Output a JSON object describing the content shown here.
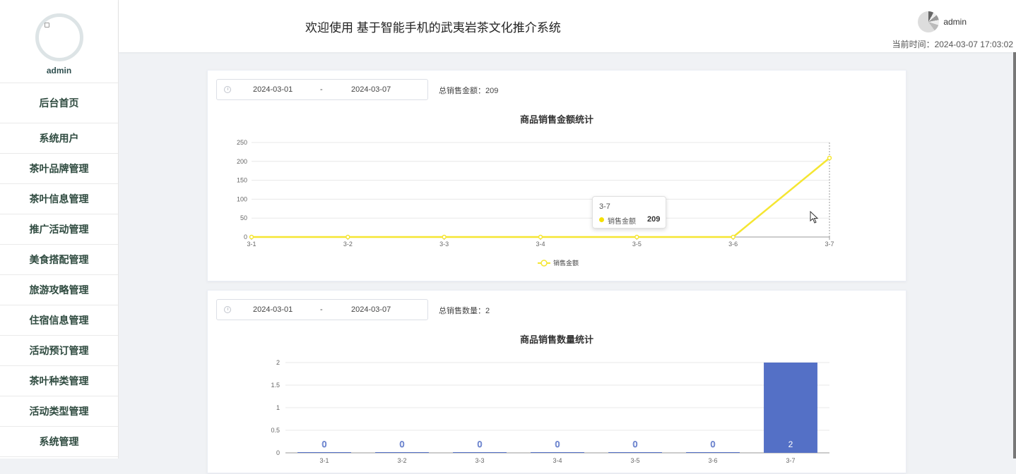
{
  "sidebar": {
    "username": "admin",
    "items": [
      {
        "label": "后台首页"
      },
      {
        "label": "系统用户"
      },
      {
        "label": "茶叶品牌管理"
      },
      {
        "label": "茶叶信息管理"
      },
      {
        "label": "推广活动管理"
      },
      {
        "label": "美食搭配管理"
      },
      {
        "label": "旅游攻略管理"
      },
      {
        "label": "住宿信息管理"
      },
      {
        "label": "活动预订管理"
      },
      {
        "label": "茶叶种类管理"
      },
      {
        "label": "活动类型管理"
      },
      {
        "label": "系统管理"
      }
    ]
  },
  "header": {
    "title": "欢迎使用 基于智能手机的武夷岩茶文化推介系统",
    "username": "admin",
    "time": "当前时间：2024-03-07 17:03:02"
  },
  "card1": {
    "date_start": "2024-03-01",
    "date_sep": "-",
    "date_end": "2024-03-07",
    "total": "总销售金额：209",
    "title": "商品销售金额统计",
    "legend": "销售金额",
    "tooltip": {
      "category": "3-7",
      "name": "销售金额",
      "value": "209"
    }
  },
  "card2": {
    "date_start": "2024-03-01",
    "date_sep": "-",
    "date_end": "2024-03-07",
    "total": "总销售数量：2",
    "title": "商品销售数量统计"
  },
  "colors": {
    "line": "#f5e632",
    "bar": "#5470c6",
    "menu_text": "#2e4a3f"
  },
  "chart_data": [
    {
      "type": "line",
      "title": "商品销售金额统计",
      "categories": [
        "3-1",
        "3-2",
        "3-3",
        "3-4",
        "3-5",
        "3-6",
        "3-7"
      ],
      "series": [
        {
          "name": "销售金额",
          "values": [
            0,
            0,
            0,
            0,
            0,
            0,
            209
          ]
        }
      ],
      "ylim": [
        0,
        250
      ],
      "yticks": [
        0,
        50,
        100,
        150,
        200,
        250
      ],
      "grid": true,
      "legend": "bottom-center"
    },
    {
      "type": "bar",
      "title": "商品销售数量统计",
      "categories": [
        "3-1",
        "3-2",
        "3-3",
        "3-4",
        "3-5",
        "3-6",
        "3-7"
      ],
      "values": [
        0,
        0,
        0,
        0,
        0,
        0,
        2
      ],
      "data_labels": [
        "0",
        "0",
        "0",
        "0",
        "0",
        "0",
        "2"
      ],
      "ylim": [
        0,
        2
      ],
      "yticks": [
        "0",
        "0.5",
        "1",
        "1.5",
        "2"
      ],
      "grid": true
    }
  ]
}
